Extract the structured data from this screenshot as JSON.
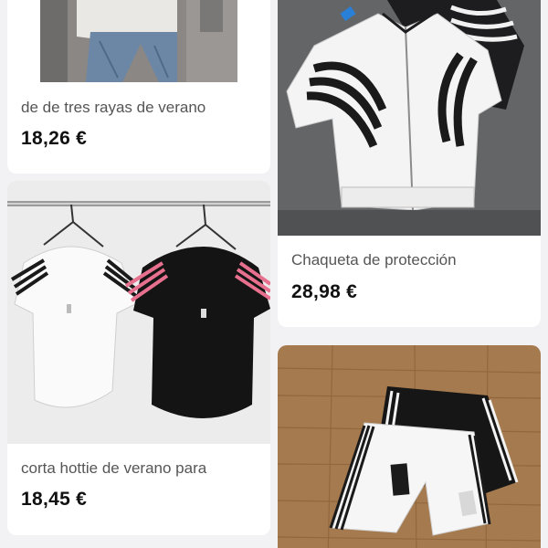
{
  "feed": {
    "products": [
      {
        "title": "de de tres rayas de verano",
        "price": "18,26 €",
        "image": "model-jeans-photo"
      },
      {
        "title": "Chaqueta de protección",
        "price": "28,98 €",
        "image": "white-black-stripe-jacket-photo"
      },
      {
        "title": "corta hottie de verano para",
        "price": "18,45 €",
        "image": "striped-tshirts-on-hangers-photo"
      },
      {
        "title": "",
        "price": "",
        "image": "striped-shorts-on-wood-floor-photo"
      }
    ]
  }
}
